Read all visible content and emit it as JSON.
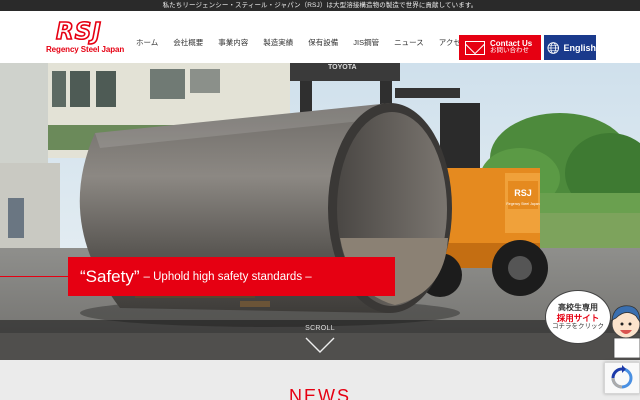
{
  "topbar": {
    "text": "私たちリージェンシー・スティール・ジャパン（RSJ）は大型溶接構造物の製造で世界に貢献しています。"
  },
  "brand": {
    "mark": "RSJ",
    "name": "Regency Steel Japan",
    "color": "#e60012"
  },
  "nav": {
    "items": [
      {
        "label": "ホーム"
      },
      {
        "label": "会社概要"
      },
      {
        "label": "事業内容"
      },
      {
        "label": "製造実績"
      },
      {
        "label": "保有設備"
      },
      {
        "label": "JIS鋼管"
      },
      {
        "label": "ニュース"
      },
      {
        "label": "アクセス"
      }
    ]
  },
  "contact": {
    "label": "Contact Us",
    "sublabel": "お問い合わせ",
    "icon": "mail-icon",
    "color": "#e60012"
  },
  "language": {
    "label": "English",
    "icon": "globe-icon",
    "color": "#1a3a8c"
  },
  "hero": {
    "caption_main": "“Safety”",
    "caption_sub": "– Uphold high safety standards –",
    "forklift_brand": "TOYOTA",
    "forklift_badge": "RSJ",
    "forklift_badge_sub": "Regency Steel Japan"
  },
  "scroll": {
    "label": "SCROLL",
    "icon": "chevron-down-icon"
  },
  "recruit": {
    "line1": "高校生専用",
    "line2": "採用サイト",
    "line3": "コチラをクリック"
  },
  "news": {
    "title": "NEWS"
  }
}
